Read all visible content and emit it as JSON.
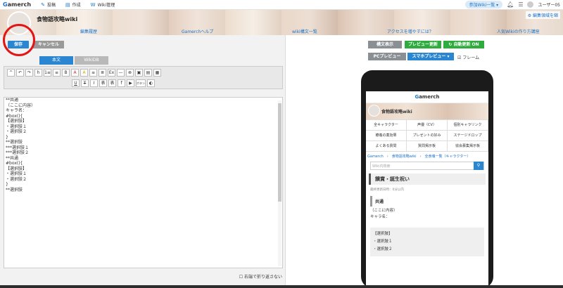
{
  "topbar": {
    "logo": "amerch",
    "logo_initial": "G",
    "nav": [
      {
        "icon": "pencil-icon",
        "label": "投稿"
      },
      {
        "icon": "document-icon",
        "label": "作成"
      },
      {
        "icon": "wiki-icon",
        "label": "Wiki管理"
      }
    ],
    "joined_wiki": "参加Wiki一覧",
    "user": "ユーザー05"
  },
  "banner": {
    "site_title": "食物語攻略wiki",
    "edit_banner": "編集領域を縮",
    "nav": [
      "編集履歴",
      "Gamerchヘルプ",
      "wiki構文一覧",
      "アクセスを増やすには？",
      "人気Wikiの作り方講座"
    ]
  },
  "editor": {
    "save": "保存",
    "cancel": "キャンセル",
    "tabs": [
      "本文",
      "WikiDB"
    ],
    "lines": [
      "**共通",
      "（ここに内容）",
      "キャラ名：",
      "",
      "#box(){",
      "【選択肢】",
      "・選択肢１",
      "・選択肢２",
      "}",
      "**選択肢",
      "***選択肢１",
      "",
      "***選択肢２",
      "",
      "**共通",
      "",
      "",
      "",
      "",
      "",
      "#box(){",
      "【選択肢】",
      "・選択肢１",
      "・選択肢２",
      "}",
      "**選択肢"
    ],
    "wrap_option": "右端で折り返さない",
    "toolbar_row1": [
      "^",
      "↶",
      "↷",
      "h",
      "1≡",
      "≡",
      "B",
      "A",
      "A",
      "≡",
      "≣",
      "Ex",
      "—",
      "⊗",
      "▣",
      "▤",
      "▦"
    ],
    "toolbar_row2": [
      "U",
      "T",
      "I",
      "表",
      "表",
      "f",
      "▶",
      "ボタン",
      "◐"
    ]
  },
  "preview": {
    "syntax_display": "構文表示",
    "preview_update": "プレビュー更新",
    "auto_update": "自動更新 ON",
    "pc_preview": "PCプレビュー",
    "sp_preview": "スマホプレビュー",
    "frame": "フレーム",
    "mobile": {
      "logo": "amerch",
      "logo_initial": "G",
      "site_title": "食物語攻略wiki",
      "menu": [
        "全キャラクター",
        "声優（CV）",
        "個別キャラリンク",
        "療養の薬効果",
        "プレゼントの好み",
        "ステージドロップ",
        "よくある質問",
        "質問掲示板",
        "協会募集掲示板"
      ],
      "breadcrumb": "Gamerch　›　食物語攻略wiki　›　全食魂一覧（キャラクター）",
      "search_placeholder": "Wiki内検索",
      "page_title": "饋賞・誕生祝い",
      "updated": "最終更新日時：0分以内",
      "section": "共通",
      "content": "（ここに内容）",
      "chara": "キャラ名：",
      "box": [
        "【選択肢】",
        "・選択肢１",
        "・選択肢２"
      ]
    }
  }
}
